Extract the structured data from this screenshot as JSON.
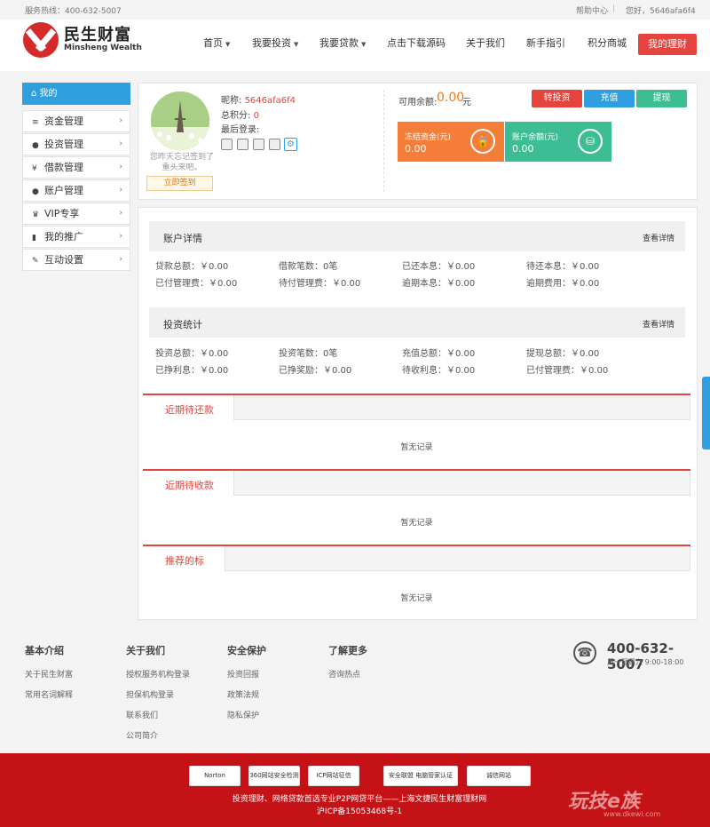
{
  "topbar": {
    "hotline": "服务热线：400-632-5007",
    "help": "帮助中心",
    "separator": "|",
    "hello": "您好，5646afa6f4"
  },
  "logo": {
    "cn": "民生财富",
    "en": "Minsheng Wealth"
  },
  "nav": [
    {
      "label": "首页",
      "caret": "▼"
    },
    {
      "label": "我要投资",
      "caret": "▼"
    },
    {
      "label": "我要贷款",
      "caret": "▼"
    },
    {
      "label": "点击下载源码",
      "caret": ""
    },
    {
      "label": "关于我们",
      "caret": ""
    },
    {
      "label": "新手指引",
      "caret": ""
    },
    {
      "label": "积分商城",
      "caret": ""
    }
  ],
  "my_finance": "我的理财",
  "sidebar": {
    "head": "我的",
    "items": [
      {
        "label": "资金管理",
        "icon": "≡"
      },
      {
        "label": "投资管理",
        "icon": "●"
      },
      {
        "label": "借款管理",
        "icon": "¥"
      },
      {
        "label": "账户管理",
        "icon": "●"
      },
      {
        "label": "VIP专享",
        "icon": "♛"
      },
      {
        "label": "我的推广",
        "icon": "▮"
      },
      {
        "label": "互动设置",
        "icon": "✎"
      }
    ]
  },
  "user": {
    "nick_label": "昵称:",
    "nick": "5646afa6f4",
    "points_label": "总积分:",
    "points": "0",
    "last_login_label": "最后登录:",
    "tip": "您昨天忘记签到了 重头来吧。",
    "sign_btn": "立即签到"
  },
  "balance": {
    "label": "可用余额:",
    "value": "0.00",
    "unit": "元"
  },
  "actions": {
    "invest": "转投资",
    "recharge": "充值",
    "withdraw": "提现"
  },
  "cards": [
    {
      "title": "冻结资金(元)",
      "value": "0.00",
      "icon": "🔒",
      "color": "#f47d37"
    },
    {
      "title": "账户余额(元)",
      "value": "0.00",
      "icon": "⛁",
      "color": "#3dbd94"
    }
  ],
  "account": {
    "title": "账户详情",
    "more": "查看详情",
    "rows": [
      [
        "贷款总额：￥0.00",
        "借款笔数：0笔",
        "已还本息：￥0.00",
        "待还本息：￥0.00"
      ],
      [
        "已付管理费：￥0.00",
        "待付管理费：￥0.00",
        "逾期本息：￥0.00",
        "逾期费用：￥0.00"
      ]
    ]
  },
  "invest": {
    "title": "投资统计",
    "more": "查看详情",
    "rows": [
      [
        "投资总额：￥0.00",
        "投资笔数：0笔",
        "充值总额：￥0.00",
        "提现总额：￥0.00"
      ],
      [
        "已挣利息：￥0.00",
        "已挣奖励：￥0.00",
        "待收利息：￥0.00",
        "已付管理费：￥0.00"
      ]
    ]
  },
  "tabs": [
    {
      "label": "近期待还款",
      "empty": "暂无记录"
    },
    {
      "label": "近期待收款",
      "empty": "暂无记录"
    },
    {
      "label": "推荐的标",
      "empty": "暂无记录"
    }
  ],
  "footer": {
    "cols": [
      {
        "head": "基本介绍",
        "links": [
          "关于民生财富",
          "常用名词解释"
        ]
      },
      {
        "head": "关于我们",
        "links": [
          "授权服务机构登录",
          "担保机构登录",
          "联系我们",
          "公司简介"
        ]
      },
      {
        "head": "安全保护",
        "links": [
          "投资回报",
          "政策法规",
          "隐私保护"
        ]
      },
      {
        "head": "了解更多",
        "links": [
          "咨询热点"
        ]
      }
    ],
    "phone": "400-632-5007",
    "hours": "周一至周六 9:00-18:00"
  },
  "badges": [
    "Norton SECURED",
    "360网站安全检测",
    "ICP网站征信",
    "安全联盟 电脑管家认证",
    "诚信网站"
  ],
  "copyright1": "投资理财、网络贷款首选专业P2P网贷平台——上海文捷民生财富理财网",
  "copyright2": "沪ICP备15053468号-1",
  "watermark": {
    "main": "玩技e族",
    "sub": "www.dkewl.com"
  }
}
